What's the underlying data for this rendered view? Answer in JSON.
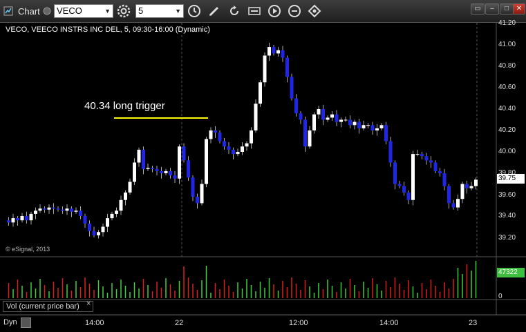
{
  "toolbar": {
    "title": "Chart",
    "symbol": "VECO",
    "interval": "5"
  },
  "chart": {
    "header": "VECO, VEECO INSTRS INC DEL, 5, 09:30-16:00 (Dynamic)",
    "copyright": "© eSignal, 2013",
    "annotation": "40.34 long trigger",
    "price_labels": [
      "41.20",
      "41.00",
      "40.80",
      "40.60",
      "40.40",
      "40.20",
      "40.00",
      "39.80",
      "39.60",
      "39.40",
      "39.20"
    ],
    "last_price": "39.75",
    "volume_axis": [
      "0"
    ],
    "last_volume": "47322",
    "volume_legend": "Vol (current price bar)",
    "time_labels": [
      "14:00",
      "22",
      "12:00",
      "14:00",
      "23"
    ],
    "timeframe_mode": "Dyn"
  },
  "colors": {
    "up_candle": "#ffffff",
    "down_candle": "#1f26e6",
    "trigger_line": "#ffff00",
    "volume_up": "#3fcf3f",
    "volume_down": "#d92020",
    "last_price_badge": "#ffffff",
    "last_volume_badge": "#3fbf3f"
  }
}
